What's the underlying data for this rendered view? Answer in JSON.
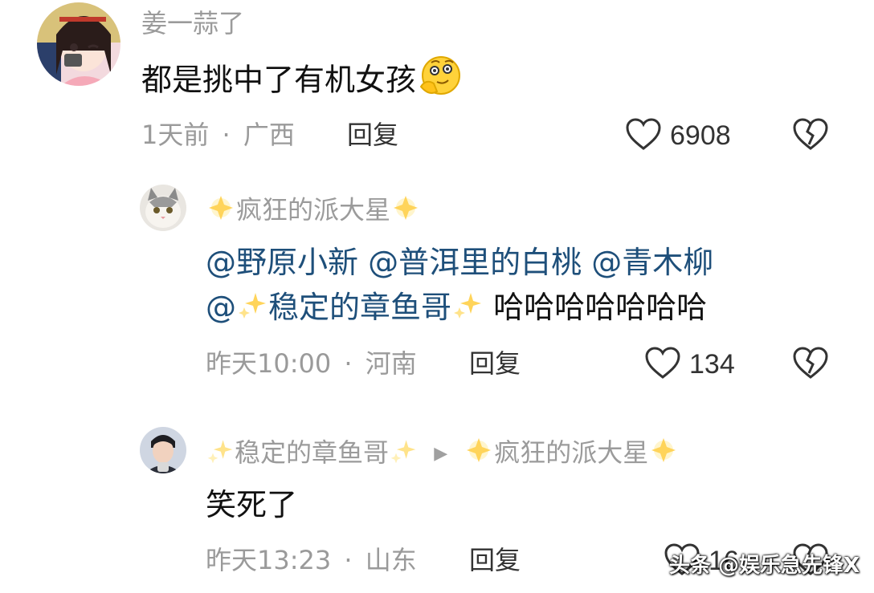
{
  "comments": [
    {
      "username": "姜一蒜了",
      "text": "都是挑中了有机女孩",
      "emoji_icon": "thinking-face-emoji",
      "time": "1天前",
      "location": "广西",
      "separator": "·",
      "reply_label": "回复",
      "likes": "6908"
    },
    {
      "username": "疯狂的派大星",
      "mentions_line1": [
        "@野原小新",
        "@普洱里的白桃",
        "@青木柳"
      ],
      "mention_line2_prefix": "@",
      "mention_line2_name": "稳定的章鱼哥",
      "text_after": "哈哈哈哈哈哈哈",
      "time": "昨天10:00",
      "location": "河南",
      "separator": "·",
      "reply_label": "回复",
      "likes": "134"
    },
    {
      "username": "稳定的章鱼哥",
      "reply_to": "疯狂的派大星",
      "text": "笑死了",
      "time": "昨天13:23",
      "location": "山东",
      "separator": "·",
      "reply_label": "回复",
      "likes": "16"
    }
  ],
  "watermark": "头条 @娱乐急先锋X",
  "colors": {
    "mention": "#1e4f7a",
    "meta": "#9a9a9a",
    "username": "#9b9b9b"
  }
}
